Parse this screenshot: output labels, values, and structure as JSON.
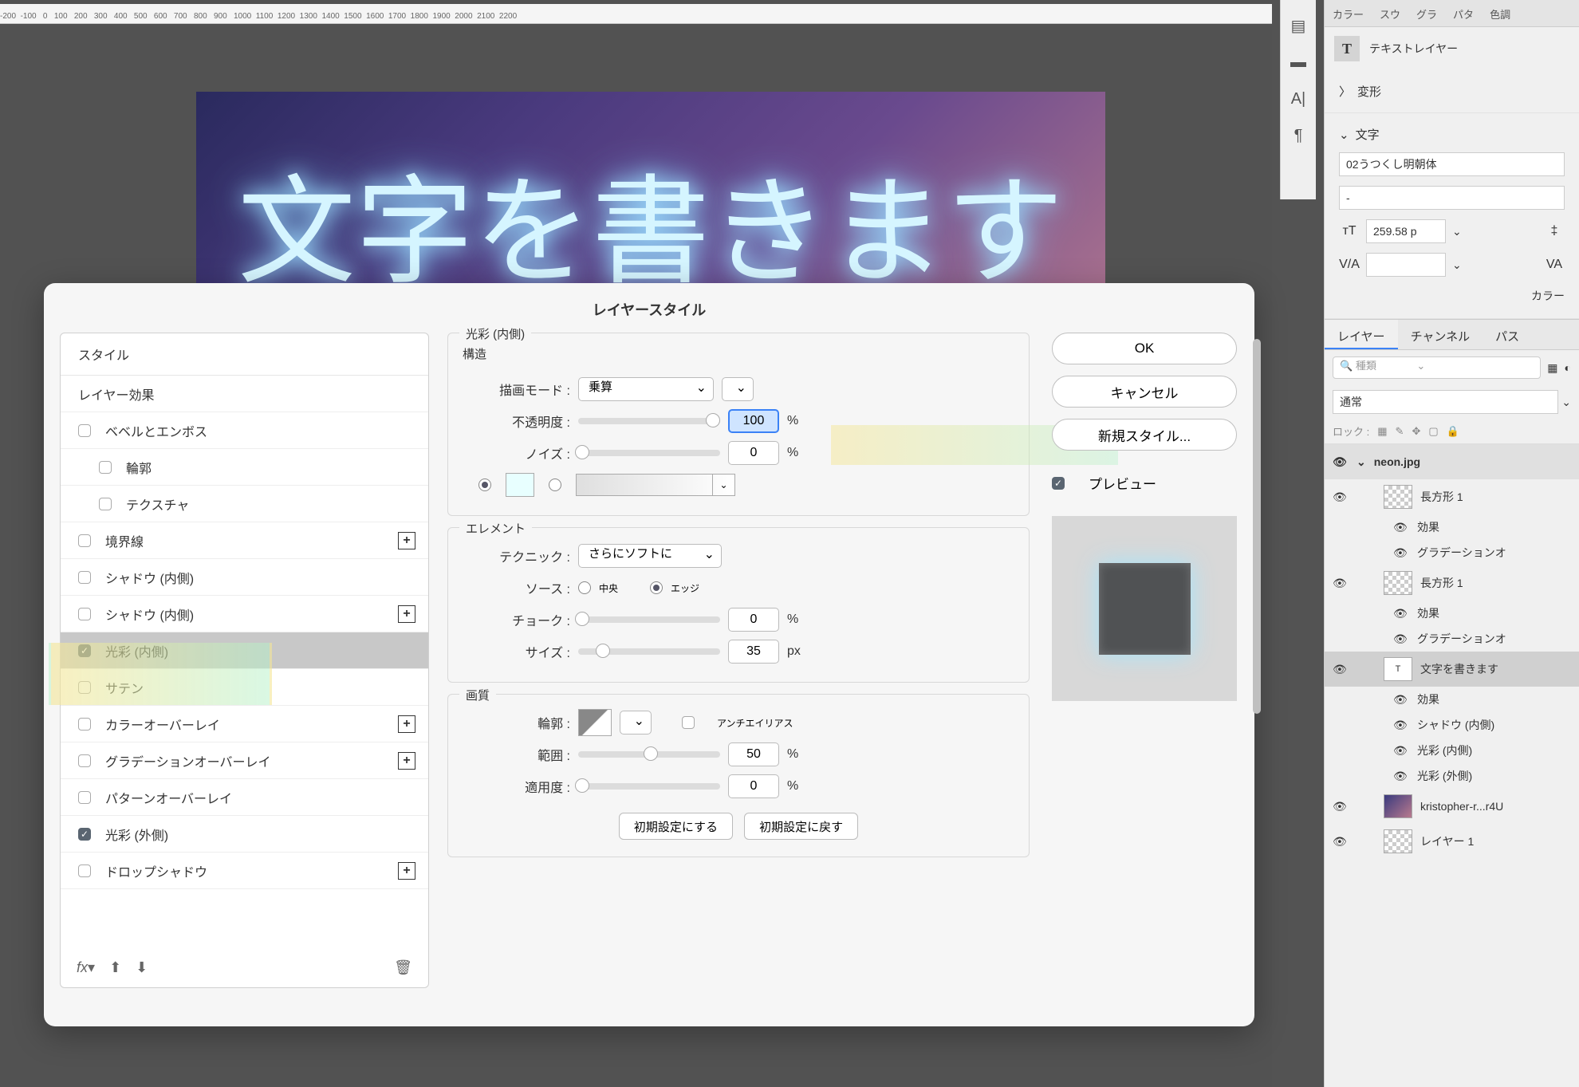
{
  "ruler": "-200  -100   0   100   200   300   400   500   600   700   800   900   1000  1100  1200  1300  1400  1500  1600  1700  1800  1900  2000  2100  2200",
  "canvas_text": "文字を書きます",
  "dialog": {
    "title": "レイヤースタイル",
    "style_header": "スタイル",
    "styles": [
      {
        "label": "レイヤー効果",
        "chk": null,
        "plus": false,
        "indent": false
      },
      {
        "label": "ベベルとエンボス",
        "chk": false,
        "plus": false,
        "indent": false
      },
      {
        "label": "輪郭",
        "chk": false,
        "plus": false,
        "indent": true
      },
      {
        "label": "テクスチャ",
        "chk": false,
        "plus": false,
        "indent": true
      },
      {
        "label": "境界線",
        "chk": false,
        "plus": true,
        "indent": false
      },
      {
        "label": "シャドウ (内側)",
        "chk": false,
        "plus": false,
        "indent": false
      },
      {
        "label": "シャドウ (内側)",
        "chk": false,
        "plus": true,
        "indent": false
      },
      {
        "label": "光彩 (内側)",
        "chk": true,
        "plus": false,
        "indent": false,
        "selected": true
      },
      {
        "label": "サテン",
        "chk": false,
        "plus": false,
        "indent": false
      },
      {
        "label": "カラーオーバーレイ",
        "chk": false,
        "plus": true,
        "indent": false
      },
      {
        "label": "グラデーションオーバーレイ",
        "chk": false,
        "plus": true,
        "indent": false
      },
      {
        "label": "パターンオーバーレイ",
        "chk": false,
        "plus": false,
        "indent": false
      },
      {
        "label": "光彩 (外側)",
        "chk": true,
        "plus": false,
        "indent": false
      },
      {
        "label": "ドロップシャドウ",
        "chk": false,
        "plus": true,
        "indent": false
      }
    ],
    "section_title": "光彩 (内側)",
    "structure_label": "構造",
    "blend_label": "描画モード :",
    "blend_value": "乗算",
    "opacity_label": "不透明度 :",
    "opacity_value": "100",
    "noise_label": "ノイズ :",
    "noise_value": "0",
    "elements_label": "エレメント",
    "technique_label": "テクニック :",
    "technique_value": "さらにソフトに",
    "source_label": "ソース :",
    "source_center": "中央",
    "source_edge": "エッジ",
    "choke_label": "チョーク :",
    "choke_value": "0",
    "size_label": "サイズ :",
    "size_value": "35",
    "px": "px",
    "pct": "%",
    "quality_label": "画質",
    "contour_label": "輪郭 :",
    "antialias_label": "アンチエイリアス",
    "range_label": "範囲 :",
    "range_value": "50",
    "jitter_label": "適用度 :",
    "jitter_value": "0",
    "reset_default": "初期設定にする",
    "reset_back": "初期設定に戻す",
    "ok": "OK",
    "cancel": "キャンセル",
    "new_style": "新規スタイル...",
    "preview_label": "プレビュー"
  },
  "rpanel": {
    "tabs": [
      "カラー",
      "スウ",
      "グラ",
      "パタ",
      "色調"
    ],
    "text_layer": "テキストレイヤー",
    "transform": "変形",
    "char": "文字",
    "font": "02うつくし明朝体",
    "font_style": "-",
    "size": "259.58 p",
    "va_value": "",
    "color_label": "カラー",
    "layers_tab": "レイヤー",
    "channels_tab": "チャンネル",
    "paths_tab": "パス",
    "search_ph": "種類",
    "blend_mode": "通常",
    "lock_label": "ロック :",
    "group": "neon.jpg",
    "layers": [
      {
        "name": "長方形 1",
        "thumb": "checker"
      },
      {
        "name": "長方形 1",
        "thumb": "checker"
      },
      {
        "name": "文字を書きます",
        "thumb": "T",
        "selected": true
      },
      {
        "name": "kristopher-r...r4U",
        "thumb": "img"
      },
      {
        "name": "レイヤー 1",
        "thumb": "checker"
      }
    ],
    "fx_label": "効果",
    "fx_grad": "グラデーションオ",
    "fx_shadow_inner": "シャドウ (内側)",
    "fx_glow_inner": "光彩 (内側)",
    "fx_glow_outer": "光彩 (外側)"
  }
}
